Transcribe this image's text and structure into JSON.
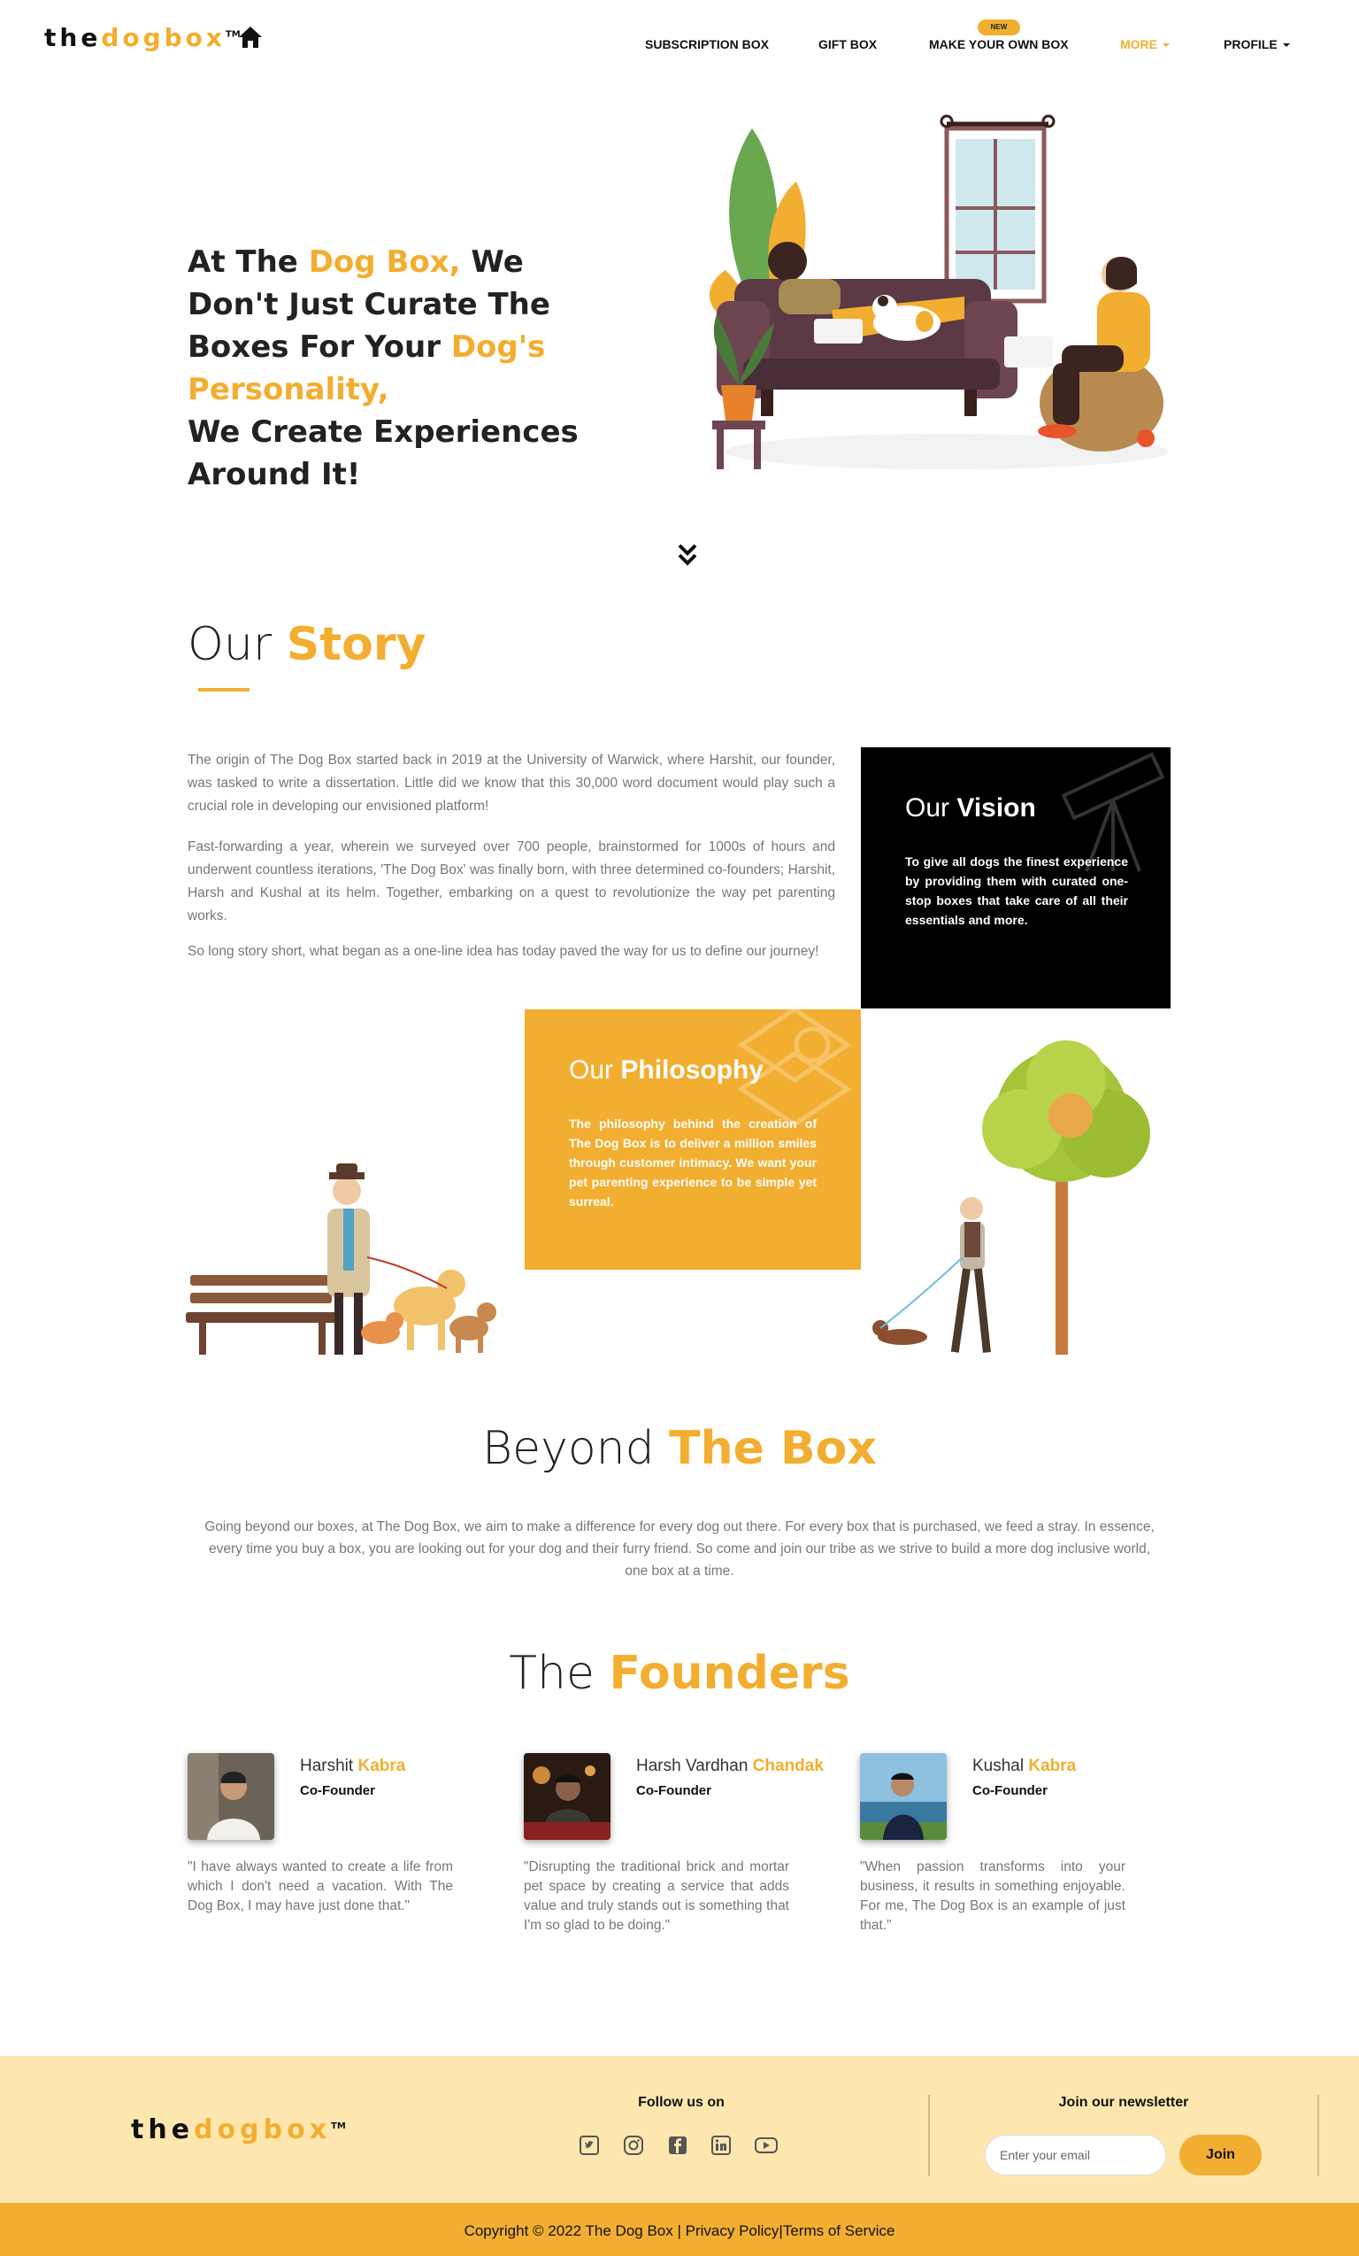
{
  "brand": {
    "logo_the": "the",
    "logo_dogbox": "dogbox",
    "trademark": "TM"
  },
  "nav": {
    "items": [
      {
        "label": "SUBSCRIPTION BOX"
      },
      {
        "label": "GIFT BOX"
      },
      {
        "label": "MAKE YOUR OWN BOX",
        "badge": "NEW"
      },
      {
        "label": "MORE"
      },
      {
        "label": "PROFILE"
      }
    ]
  },
  "hero": {
    "line1_a": "At The ",
    "line1_accent": "Dog Box,",
    "line1_b": " We Don't Just Curate The Boxes For Your ",
    "line2_accent": "Dog's Personality,",
    "line2_b": " We Create Experiences Around It!"
  },
  "story": {
    "title_light": "Our ",
    "title_bold": "Story",
    "paragraphs": [
      "The origin of The Dog Box started back in 2019 at the University of Warwick, where Harshit, our founder, was tasked to write a dissertation. Little did we know that this 30,000 word document would play such a crucial role in developing our envisioned platform!",
      "Fast-forwarding a year, wherein we surveyed over 700 people, brainstormed for 1000s of hours and underwent countless iterations, 'The Dog Box' was finally born, with three determined co-founders; Harshit, Harsh and Kushal at its helm. Together, embarking on a quest to revolutionize the way pet parenting works.",
      "So long story short, what began as a one-line idea has today paved the way for us to define our journey!"
    ]
  },
  "vision": {
    "title_light": "Our ",
    "title_bold": "Vision",
    "text": "To give all dogs the finest experience by providing them with curated one-stop boxes that take care of all their essentials and more."
  },
  "philosophy": {
    "title_light": "Our ",
    "title_bold": "Philosophy",
    "text": "The philosophy behind the creation of The Dog Box is to deliver a million smiles through customer intimacy. We want your pet parenting experience to be simple yet surreal."
  },
  "beyond": {
    "title_light": "Beyond ",
    "title_bold": "The Box",
    "text": "Going beyond our boxes, at The Dog Box, we aim to make a difference for every dog out there. For every box that is purchased, we feed a stray. In essence, every time you buy a box, you are looking out for your dog and their furry friend. So come and join our tribe as we strive to build a more dog inclusive world, one box at a time."
  },
  "founders": {
    "title_light": "The ",
    "title_bold": "Founders",
    "people": [
      {
        "first": "Harshit ",
        "last": "Kabra",
        "role": "Co-Founder",
        "quote": "\"I have always wanted to create a life from which I don't need a vacation. With The Dog Box, I may have just done that.\""
      },
      {
        "first": "Harsh Vardhan ",
        "last": "Chandak",
        "role": "Co-Founder",
        "quote": "\"Disrupting the traditional brick and mortar pet space by creating a service that adds value and truly stands out is something that I'm so glad to be doing.\""
      },
      {
        "first": "Kushal ",
        "last": "Kabra",
        "role": "Co-Founder",
        "quote": "\"When passion transforms into your business, it results in something enjoyable. For me, The Dog Box is an example of just that.\""
      }
    ]
  },
  "footer": {
    "follow_title": "Follow us on",
    "social_icons": [
      "twitter-icon",
      "instagram-icon",
      "facebook-icon",
      "linkedin-icon",
      "youtube-icon"
    ],
    "newsletter_title": "Join our newsletter",
    "email_placeholder": "Enter your email",
    "join_label": "Join",
    "copyright": "Copyright © 2022 The Dog Box | ",
    "privacy": "Privacy Policy",
    "separator": "|",
    "terms": "Terms of Service"
  },
  "colors": {
    "accent": "#F2AE30",
    "footer_bg": "#FEE7AF",
    "vision_bg": "#000000"
  }
}
